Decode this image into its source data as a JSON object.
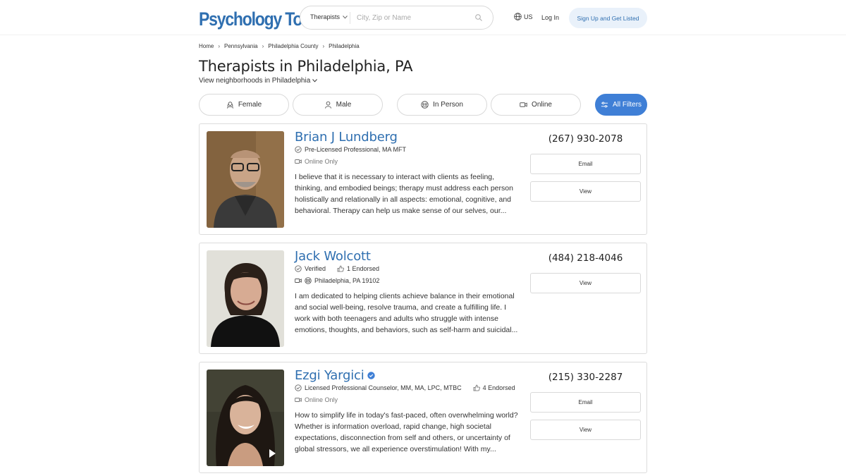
{
  "header": {
    "logo_text": "Psychology Today",
    "search_type": "Therapists",
    "search_placeholder": "City, Zip or Name",
    "region": "US",
    "login": "Log In",
    "signup": "Sign Up and Get Listed"
  },
  "breadcrumb": [
    "Home",
    "Pennsylvania",
    "Philadelphia County",
    "Philadelphia"
  ],
  "title": "Therapists in Philadelphia, PA",
  "neighborhoods_link": "View neighborhoods in Philadelphia",
  "filters": [
    {
      "label": "Female",
      "icon": "female-icon"
    },
    {
      "label": "Male",
      "icon": "male-icon"
    },
    {
      "label": "In Person",
      "icon": "in-person-icon"
    },
    {
      "label": "Online",
      "icon": "video-icon"
    },
    {
      "label": "All Filters",
      "icon": "filters-icon"
    }
  ],
  "therapists": [
    {
      "name": "Brian J Lundberg",
      "credential": "Pre-Licensed Professional, MA MFT",
      "location": "Online Only",
      "bio": "I believe that it is necessary to interact with clients as feeling, thinking, and embodied beings; therapy must address each person holistically and relationally in all aspects: emotional, cognitive, and behavioral. Therapy can help us make sense of our selves, our...",
      "phone": "(267) 930-2078",
      "email_label": "Email",
      "view_label": "View"
    },
    {
      "name": "Jack Wolcott",
      "credential": "Verified",
      "endorsed": "1 Endorsed",
      "location": "Philadelphia, PA 19102",
      "bio": "I am dedicated to helping clients achieve balance in their emotional and social well-being, resolve trauma, and create a fulfilling life. I work with both teenagers and adults who struggle with intense emotions, thoughts, and behaviors, such as self-harm and suicidal...",
      "phone": "(484) 218-4046",
      "view_label": "View"
    },
    {
      "name": "Ezgi Yargici",
      "credential": "Licensed Professional Counselor, MM, MA, LPC, MTBC",
      "endorsed": "4 Endorsed",
      "location": "Online Only",
      "bio": "How to simplify life in today's fast-paced, often overwhelming world? Whether is information overload, rapid change, high societal expectations, disconnection from self and others, or uncertainty of global stressors, we all experience overstimulation! With my...",
      "phone": "(215) 330-2287",
      "email_label": "Email",
      "view_label": "View"
    }
  ]
}
